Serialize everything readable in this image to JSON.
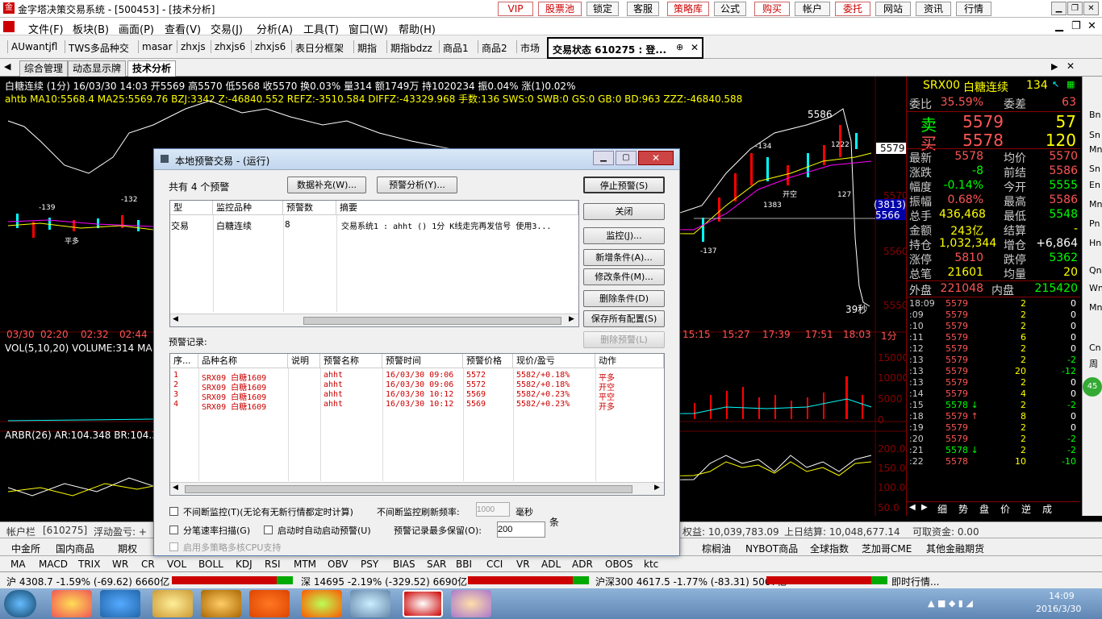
{
  "window": {
    "title": "金字塔决策交易系统 - [500453] - [技术分析]",
    "top_buttons": [
      "VIP",
      "股票池",
      "锁定",
      "客服",
      "策略库",
      "公式",
      "购买",
      "帐户",
      "委托",
      "网站",
      "资讯",
      "行情"
    ]
  },
  "menu": [
    "文件(F)",
    "板块(B)",
    "画面(P)",
    "查看(V)",
    "交易(J)",
    "分析(A)",
    "工具(T)",
    "窗口(W)",
    "帮助(H)"
  ],
  "navbar": [
    "AUwantjfl",
    "TWS多品种交",
    "masar",
    "zhxjs",
    "zhxjs6",
    "zhxjs6",
    "表日分框架",
    "期指",
    "期指bdzz",
    "商品1",
    "商品2",
    "市场"
  ],
  "trade_status": "交易状态 610275 : 登...",
  "tabs": [
    "综合管理",
    "动态显示牌",
    "技术分析"
  ],
  "chart": {
    "info_line1": "白糖连续 (1分) 16/03/30 14:03 开5569 高5570 低5568 收5570 换0.03% 量314 额1749万 持1020234 振0.04% 涨(1)0.02%",
    "info_line2": "ahtb MA10:5568.4 MA25:5569.76 BZJ:3342 Z:-46840.552 REFZ:-3510.584 DIFFZ:-43329.968 手数:136 SWS:0 SWB:0 GS:0 GB:0 BD:963 ZZZ:-46840.588",
    "price_labels": [
      "5586",
      "5579",
      "(3813)",
      "5566",
      "5570",
      "5560",
      "5550",
      "39秒"
    ],
    "time_labels": [
      "03/30",
      "02:20",
      "02:32",
      "02:44",
      "15:15",
      "15:27",
      "17:39",
      "17:51",
      "18:03",
      "1分"
    ],
    "vol_line": "VOL(5,10,20) VOLUME:314 MA",
    "vol_axis": [
      "15000",
      "10000",
      "5000",
      "0"
    ],
    "arbr_line": "ARBR(26) AR:104.348 BR:104.3",
    "arbr_axis": [
      "200.0",
      "150.0",
      "100.0",
      "50.0"
    ],
    "signals": [
      "平多",
      "开空",
      "-139",
      "-132",
      "-137",
      "-134",
      "1383",
      "127",
      "1222"
    ]
  },
  "quote": {
    "code": "SRX00",
    "name": "白糖连续",
    "num": "134",
    "weibi_label": "委比",
    "weibi": "35.59%",
    "weicha_label": "委差",
    "weicha": "63",
    "sell_label": "卖",
    "sell_price": "5579",
    "sell_vol": "57",
    "buy_label": "买",
    "buy_price": "5578",
    "buy_vol": "120",
    "rows": [
      {
        "l1": "最新",
        "v1": "5578",
        "l2": "均价",
        "v2": "5570"
      },
      {
        "l1": "涨跌",
        "v1": "-8",
        "l2": "前结",
        "v2": "5586"
      },
      {
        "l1": "幅度",
        "v1": "-0.14%",
        "l2": "今开",
        "v2": "5555"
      },
      {
        "l1": "振幅",
        "v1": "0.68%",
        "l2": "最高",
        "v2": "5586"
      },
      {
        "l1": "总手",
        "v1": "436,468",
        "l2": "最低",
        "v2": "5548"
      },
      {
        "l1": "金额",
        "v1": "243亿",
        "l2": "结算",
        "v2": "-"
      },
      {
        "l1": "持仓",
        "v1": "1,032,344",
        "l2": "增仓",
        "v2": "+6,864"
      },
      {
        "l1": "涨停",
        "v1": "5810",
        "l2": "跌停",
        "v2": "5362"
      },
      {
        "l1": "总笔",
        "v1": "21601",
        "l2": "均量",
        "v2": "20"
      }
    ],
    "waipan_label": "外盘",
    "waipan": "221048",
    "neipan_label": "内盘",
    "neipan": "215420",
    "ticks": [
      {
        "t": "18:09",
        "p": "5579",
        "v": "2",
        "d": "0"
      },
      {
        "t": ":09",
        "p": "5579",
        "v": "2",
        "d": "0"
      },
      {
        "t": ":10",
        "p": "5579",
        "v": "2",
        "d": "0"
      },
      {
        "t": ":11",
        "p": "5579",
        "v": "6",
        "d": "0"
      },
      {
        "t": ":12",
        "p": "5579",
        "v": "2",
        "d": "0"
      },
      {
        "t": ":13",
        "p": "5579",
        "v": "2",
        "d": "-2"
      },
      {
        "t": ":13",
        "p": "5579",
        "v": "20",
        "d": "-12"
      },
      {
        "t": ":13",
        "p": "5579",
        "v": "2",
        "d": "0"
      },
      {
        "t": ":14",
        "p": "5579",
        "v": "4",
        "d": "0"
      },
      {
        "t": ":15",
        "p": "5578 ↓",
        "v": "2",
        "d": "-2"
      },
      {
        "t": ":18",
        "p": "5579 ↑",
        "v": "8",
        "d": "0"
      },
      {
        "t": ":19",
        "p": "5579",
        "v": "2",
        "d": "0"
      },
      {
        "t": ":20",
        "p": "5579",
        "v": "2",
        "d": "-2"
      },
      {
        "t": ":21",
        "p": "5578 ↓",
        "v": "2",
        "d": "-2"
      },
      {
        "t": ":22",
        "p": "5578",
        "v": "10",
        "d": "-10"
      }
    ],
    "bottom_tabs": [
      "细",
      "势",
      "盘",
      "价",
      "逆",
      "成"
    ]
  },
  "sidebar": [
    "Bn",
    "Sn",
    "Mn",
    "Sn",
    "En",
    "Mn",
    "Pn",
    "Hn",
    "Qn",
    "Wn",
    "Mn",
    "Cn",
    "周"
  ],
  "account_bar": {
    "label": "帐户栏",
    "account": "[610275]",
    "float": "浮动盈亏: +",
    "equity": "权益: 10,039,783.09",
    "settle": "上日结算: 10,048,677.14",
    "avail": "可取资金: 0.00"
  },
  "bottom_tabs": [
    "中金所",
    "国内商品",
    "期权",
    "棕榈油",
    "NYBOT商品",
    "全球指数",
    "芝加哥CME",
    "其他金融期货"
  ],
  "indicators": [
    "MA",
    "MACD",
    "TRIX",
    "WR",
    "CR",
    "VOL",
    "BOLL",
    "KDJ",
    "RSI",
    "MTM",
    "OBV",
    "PSY",
    "BIAS",
    "SAR",
    "BBI",
    "CCI",
    "VR",
    "ADL",
    "ADR",
    "OBOS",
    "ktc"
  ],
  "status": {
    "sh": "沪 4308.7 -1.59% (-69.62) 6660亿",
    "sz": "深 14695 -2.19% (-329.52) 6690亿",
    "hs300": "沪深300 4617.5 -1.77% (-83.31) 5067亿",
    "news": "即时行情..."
  },
  "clock": {
    "time": "14:09",
    "date": "2016/3/30"
  },
  "dialog": {
    "title": "本地预警交易 - (运行)",
    "count_text": "共有 4 个预警",
    "btn_data": "数据补充(W)...",
    "btn_analysis": "预警分析(Y)...",
    "btn_stop": "停止预警(S)",
    "btn_close": "关闭",
    "btn_monitor": "监控(J)...",
    "btn_add": "新增条件(A)...",
    "btn_modify": "修改条件(M)...",
    "btn_delete": "删除条件(D)",
    "btn_save": "保存所有配置(S)",
    "btn_delwarn": "删除预警(L)",
    "top_headers": [
      "型",
      "监控品种",
      "预警数",
      "摘要"
    ],
    "top_rows": [
      [
        "交易",
        "白糖连续",
        "8",
        "交易系统1 : ahht () 1分 K线走完再发信号 使用3..."
      ]
    ],
    "record_label": "预警记录:",
    "rec_headers": [
      "序...",
      "品种名称",
      "说明",
      "预警名称",
      "预警时间",
      "预警价格",
      "现价/盈亏",
      "动作"
    ],
    "rec_rows": [
      [
        "1",
        "SRX09 白糖1609",
        "",
        "ahht",
        "16/03/30 09:06",
        "5572",
        "5582/+0.18%",
        "平多"
      ],
      [
        "2",
        "SRX09 白糖1609",
        "",
        "ahht",
        "16/03/30 09:06",
        "5572",
        "5582/+0.18%",
        "开空"
      ],
      [
        "3",
        "SRX09 白糖1609",
        "",
        "ahht",
        "16/03/30 10:12",
        "5569",
        "5582/+0.23%",
        "平空"
      ],
      [
        "4",
        "SRX09 白糖1609",
        "",
        "ahht",
        "16/03/30 10:12",
        "5569",
        "5582/+0.23%",
        "开多"
      ]
    ],
    "chk1": "不间断监控(T)(无论有无新行情都定时计算)",
    "refresh_label": "不间断监控刷新频率:",
    "refresh_value": "1000",
    "refresh_unit": "毫秒",
    "chk2": "分笔速率扫描(G)",
    "chk3": "启动时自动启动预警(U)",
    "max_label": "预警记录最多保留(O):",
    "max_value": "200",
    "max_unit": "条",
    "chk4": "启用多策略多核CPU支持"
  }
}
